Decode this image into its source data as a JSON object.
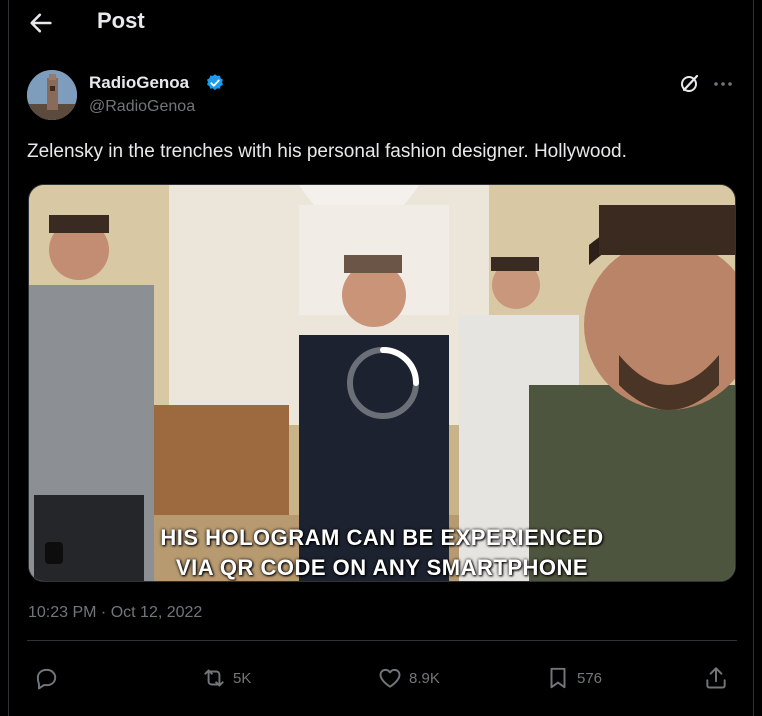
{
  "header": {
    "title": "Post",
    "back_icon": "arrow-left-icon"
  },
  "author": {
    "name": "RadioGenoa",
    "handle": "@RadioGenoa",
    "verified": true,
    "verified_color": "#1d9bf0"
  },
  "tweet": {
    "text": "Zelensky in the trenches with his personal fashion designer. Hollywood.",
    "timestamp": "10:23 PM · Oct 12, 2022"
  },
  "media": {
    "type": "video",
    "caption_line1": "HIS HOLOGRAM CAN BE EXPERIENCED",
    "caption_line2": "VIA QR CODE  ON ANY SMARTPHONE",
    "state": "loading"
  },
  "actions": {
    "reply": {
      "icon": "reply-icon",
      "count": ""
    },
    "repost": {
      "icon": "repost-icon",
      "count": "5K"
    },
    "like": {
      "icon": "heart-icon",
      "count": "8.9K"
    },
    "bookmark": {
      "icon": "bookmark-icon",
      "count": "576"
    },
    "share": {
      "icon": "share-icon",
      "count": ""
    }
  },
  "colors": {
    "background": "#000000",
    "text": "#e7e9ea",
    "secondary": "#71767b",
    "border": "#2f3336"
  }
}
